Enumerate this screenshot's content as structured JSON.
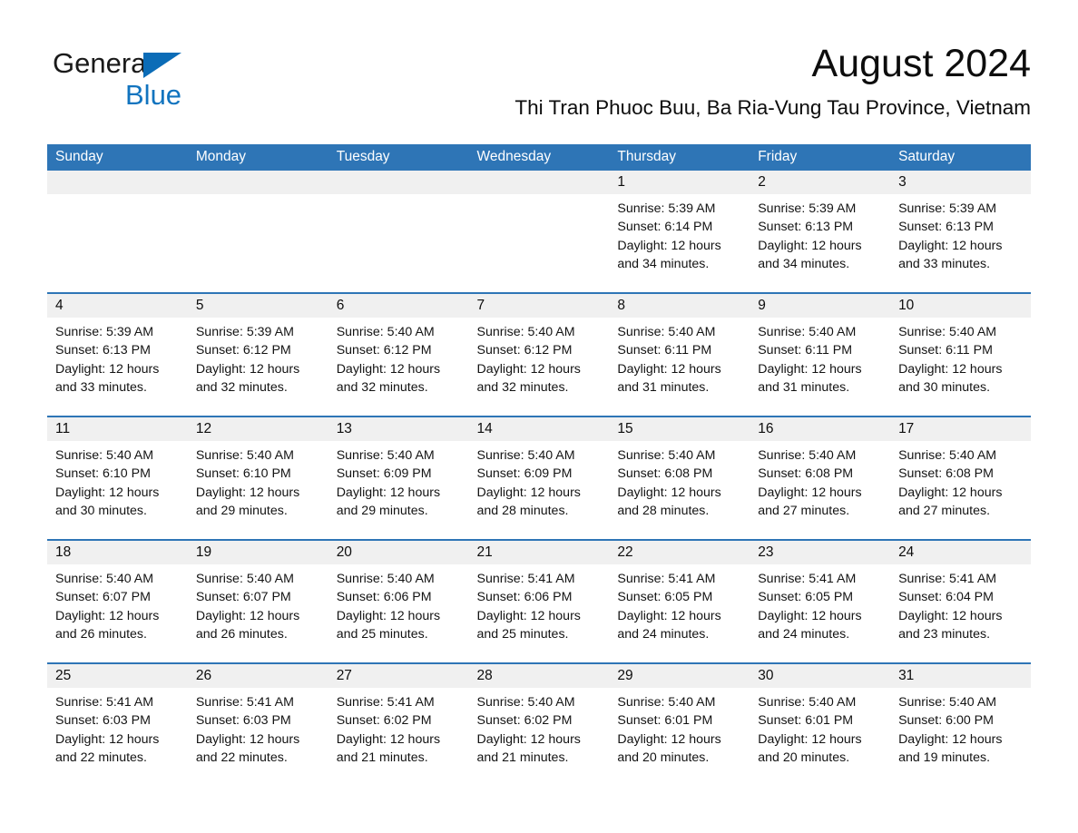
{
  "brand": {
    "name_part1": "General",
    "name_part2": "Blue",
    "logo_icon": "triangle-logo-icon",
    "accent_color": "#1274bf"
  },
  "header": {
    "month_title": "August 2024",
    "location": "Thi Tran Phuoc Buu, Ba Ria-Vung Tau Province, Vietnam"
  },
  "theme": {
    "header_blue": "#2e75b6",
    "daynum_bg": "#f0f0f0",
    "text": "#131313"
  },
  "calendar": {
    "weekday_headers": [
      "Sunday",
      "Monday",
      "Tuesday",
      "Wednesday",
      "Thursday",
      "Friday",
      "Saturday"
    ],
    "weeks": [
      [
        {
          "day": "",
          "lines": []
        },
        {
          "day": "",
          "lines": []
        },
        {
          "day": "",
          "lines": []
        },
        {
          "day": "",
          "lines": []
        },
        {
          "day": "1",
          "lines": [
            "Sunrise: 5:39 AM",
            "Sunset: 6:14 PM",
            "Daylight: 12 hours",
            "and 34 minutes."
          ]
        },
        {
          "day": "2",
          "lines": [
            "Sunrise: 5:39 AM",
            "Sunset: 6:13 PM",
            "Daylight: 12 hours",
            "and 34 minutes."
          ]
        },
        {
          "day": "3",
          "lines": [
            "Sunrise: 5:39 AM",
            "Sunset: 6:13 PM",
            "Daylight: 12 hours",
            "and 33 minutes."
          ]
        }
      ],
      [
        {
          "day": "4",
          "lines": [
            "Sunrise: 5:39 AM",
            "Sunset: 6:13 PM",
            "Daylight: 12 hours",
            "and 33 minutes."
          ]
        },
        {
          "day": "5",
          "lines": [
            "Sunrise: 5:39 AM",
            "Sunset: 6:12 PM",
            "Daylight: 12 hours",
            "and 32 minutes."
          ]
        },
        {
          "day": "6",
          "lines": [
            "Sunrise: 5:40 AM",
            "Sunset: 6:12 PM",
            "Daylight: 12 hours",
            "and 32 minutes."
          ]
        },
        {
          "day": "7",
          "lines": [
            "Sunrise: 5:40 AM",
            "Sunset: 6:12 PM",
            "Daylight: 12 hours",
            "and 32 minutes."
          ]
        },
        {
          "day": "8",
          "lines": [
            "Sunrise: 5:40 AM",
            "Sunset: 6:11 PM",
            "Daylight: 12 hours",
            "and 31 minutes."
          ]
        },
        {
          "day": "9",
          "lines": [
            "Sunrise: 5:40 AM",
            "Sunset: 6:11 PM",
            "Daylight: 12 hours",
            "and 31 minutes."
          ]
        },
        {
          "day": "10",
          "lines": [
            "Sunrise: 5:40 AM",
            "Sunset: 6:11 PM",
            "Daylight: 12 hours",
            "and 30 minutes."
          ]
        }
      ],
      [
        {
          "day": "11",
          "lines": [
            "Sunrise: 5:40 AM",
            "Sunset: 6:10 PM",
            "Daylight: 12 hours",
            "and 30 minutes."
          ]
        },
        {
          "day": "12",
          "lines": [
            "Sunrise: 5:40 AM",
            "Sunset: 6:10 PM",
            "Daylight: 12 hours",
            "and 29 minutes."
          ]
        },
        {
          "day": "13",
          "lines": [
            "Sunrise: 5:40 AM",
            "Sunset: 6:09 PM",
            "Daylight: 12 hours",
            "and 29 minutes."
          ]
        },
        {
          "day": "14",
          "lines": [
            "Sunrise: 5:40 AM",
            "Sunset: 6:09 PM",
            "Daylight: 12 hours",
            "and 28 minutes."
          ]
        },
        {
          "day": "15",
          "lines": [
            "Sunrise: 5:40 AM",
            "Sunset: 6:08 PM",
            "Daylight: 12 hours",
            "and 28 minutes."
          ]
        },
        {
          "day": "16",
          "lines": [
            "Sunrise: 5:40 AM",
            "Sunset: 6:08 PM",
            "Daylight: 12 hours",
            "and 27 minutes."
          ]
        },
        {
          "day": "17",
          "lines": [
            "Sunrise: 5:40 AM",
            "Sunset: 6:08 PM",
            "Daylight: 12 hours",
            "and 27 minutes."
          ]
        }
      ],
      [
        {
          "day": "18",
          "lines": [
            "Sunrise: 5:40 AM",
            "Sunset: 6:07 PM",
            "Daylight: 12 hours",
            "and 26 minutes."
          ]
        },
        {
          "day": "19",
          "lines": [
            "Sunrise: 5:40 AM",
            "Sunset: 6:07 PM",
            "Daylight: 12 hours",
            "and 26 minutes."
          ]
        },
        {
          "day": "20",
          "lines": [
            "Sunrise: 5:40 AM",
            "Sunset: 6:06 PM",
            "Daylight: 12 hours",
            "and 25 minutes."
          ]
        },
        {
          "day": "21",
          "lines": [
            "Sunrise: 5:41 AM",
            "Sunset: 6:06 PM",
            "Daylight: 12 hours",
            "and 25 minutes."
          ]
        },
        {
          "day": "22",
          "lines": [
            "Sunrise: 5:41 AM",
            "Sunset: 6:05 PM",
            "Daylight: 12 hours",
            "and 24 minutes."
          ]
        },
        {
          "day": "23",
          "lines": [
            "Sunrise: 5:41 AM",
            "Sunset: 6:05 PM",
            "Daylight: 12 hours",
            "and 24 minutes."
          ]
        },
        {
          "day": "24",
          "lines": [
            "Sunrise: 5:41 AM",
            "Sunset: 6:04 PM",
            "Daylight: 12 hours",
            "and 23 minutes."
          ]
        }
      ],
      [
        {
          "day": "25",
          "lines": [
            "Sunrise: 5:41 AM",
            "Sunset: 6:03 PM",
            "Daylight: 12 hours",
            "and 22 minutes."
          ]
        },
        {
          "day": "26",
          "lines": [
            "Sunrise: 5:41 AM",
            "Sunset: 6:03 PM",
            "Daylight: 12 hours",
            "and 22 minutes."
          ]
        },
        {
          "day": "27",
          "lines": [
            "Sunrise: 5:41 AM",
            "Sunset: 6:02 PM",
            "Daylight: 12 hours",
            "and 21 minutes."
          ]
        },
        {
          "day": "28",
          "lines": [
            "Sunrise: 5:40 AM",
            "Sunset: 6:02 PM",
            "Daylight: 12 hours",
            "and 21 minutes."
          ]
        },
        {
          "day": "29",
          "lines": [
            "Sunrise: 5:40 AM",
            "Sunset: 6:01 PM",
            "Daylight: 12 hours",
            "and 20 minutes."
          ]
        },
        {
          "day": "30",
          "lines": [
            "Sunrise: 5:40 AM",
            "Sunset: 6:01 PM",
            "Daylight: 12 hours",
            "and 20 minutes."
          ]
        },
        {
          "day": "31",
          "lines": [
            "Sunrise: 5:40 AM",
            "Sunset: 6:00 PM",
            "Daylight: 12 hours",
            "and 19 minutes."
          ]
        }
      ]
    ]
  }
}
